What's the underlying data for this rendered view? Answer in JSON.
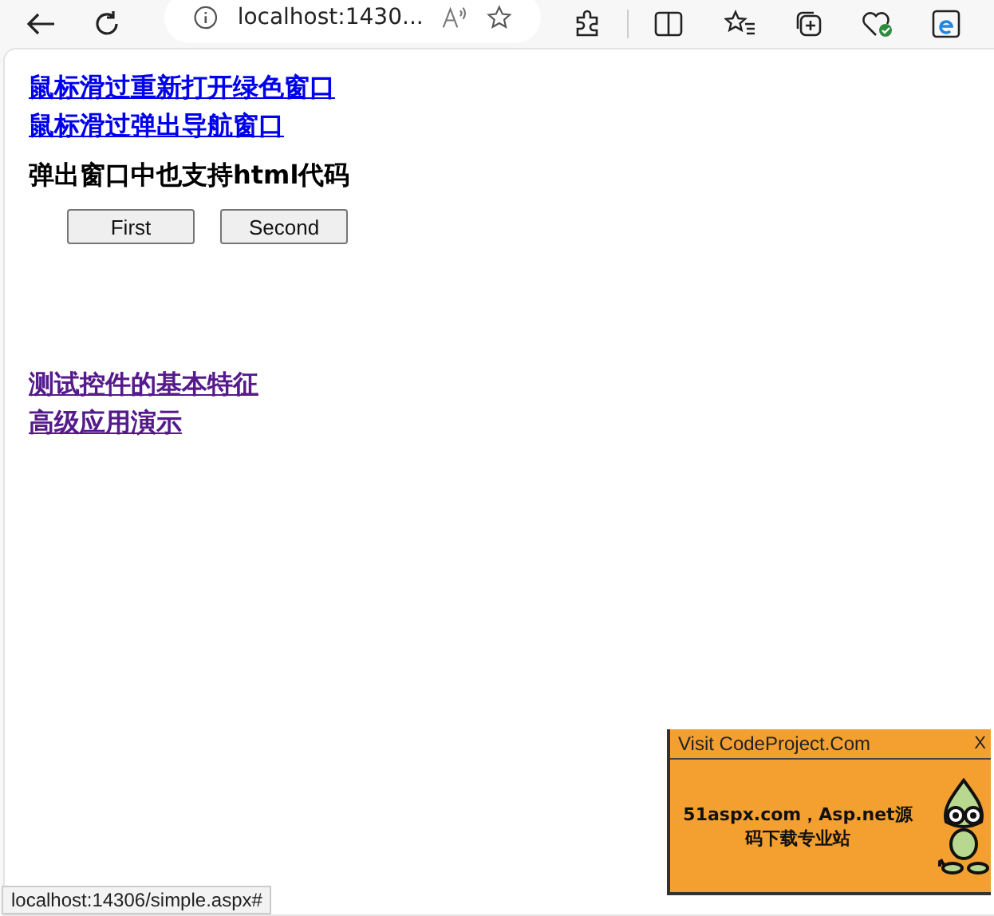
{
  "browser": {
    "address": "localhost:1430..."
  },
  "links_top": [
    {
      "text": "鼠标滑过重新打开绿色窗口",
      "visited": false
    },
    {
      "text": "鼠标滑过弹出导航窗口",
      "visited": false
    }
  ],
  "heading": "弹出窗口中也支持html代码",
  "buttons": [
    "First",
    "Second"
  ],
  "links_bottom": [
    {
      "text": "测试控件的基本特征",
      "visited": true
    },
    {
      "text": "高级应用演示",
      "visited": true
    }
  ],
  "popup": {
    "title": "Visit CodeProject.Com",
    "close": "X",
    "text": "51aspx.com，Asp.net源码下载专业站"
  },
  "status_bar": "localhost:14306/simple.aspx#"
}
